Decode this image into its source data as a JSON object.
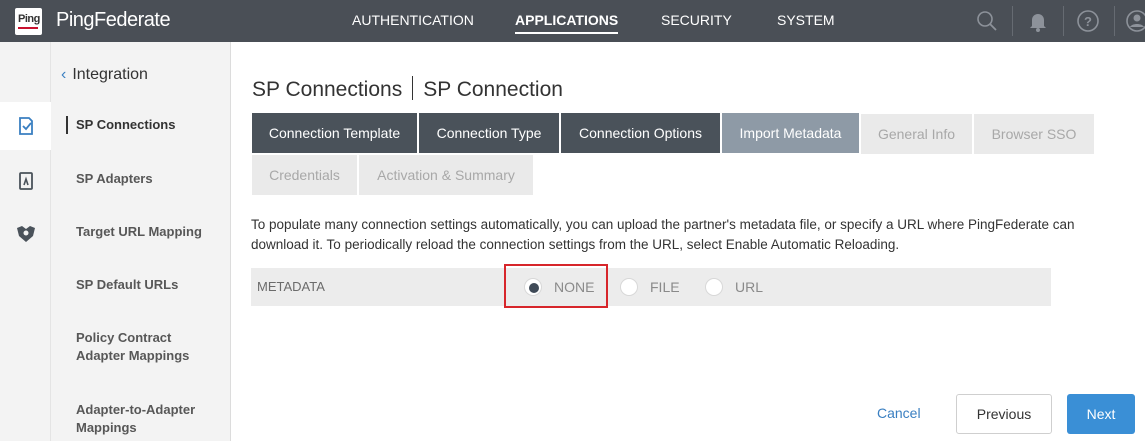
{
  "header": {
    "logo_text": "Ping",
    "brand": "PingFederate",
    "nav": [
      {
        "label": "AUTHENTICATION"
      },
      {
        "label": "APPLICATIONS"
      },
      {
        "label": "SECURITY"
      },
      {
        "label": "SYSTEM"
      }
    ],
    "icons": [
      "search-icon",
      "bell-icon",
      "help-icon",
      "user-icon"
    ]
  },
  "sidebar": {
    "back_label": "Integration",
    "items": [
      {
        "label": "SP Connections"
      },
      {
        "label": "SP Adapters"
      },
      {
        "label": "Target URL Mapping"
      },
      {
        "label": "SP Default URLs"
      },
      {
        "label": "Policy Contract Adapter Mappings"
      },
      {
        "label": "Adapter-to-Adapter Mappings"
      }
    ]
  },
  "page": {
    "breadcrumb_parent": "SP Connections",
    "breadcrumb_current": "SP Connection"
  },
  "tabs": [
    {
      "label": "Connection Template",
      "state": "done"
    },
    {
      "label": "Connection Type",
      "state": "done"
    },
    {
      "label": "Connection Options",
      "state": "done"
    },
    {
      "label": "Import Metadata",
      "state": "current"
    },
    {
      "label": "General Info",
      "state": "future"
    },
    {
      "label": "Browser SSO",
      "state": "future"
    },
    {
      "label": "Credentials",
      "state": "future"
    },
    {
      "label": "Activation & Summary",
      "state": "future"
    }
  ],
  "description": "To populate many connection settings automatically, you can upload the partner's metadata file, or specify a URL where PingFederate can download it. To periodically reload the connection settings from the URL, select Enable Automatic Reloading.",
  "metadata": {
    "label": "METADATA",
    "options": [
      {
        "label": "NONE",
        "checked": true
      },
      {
        "label": "FILE",
        "checked": false
      },
      {
        "label": "URL",
        "checked": false
      }
    ]
  },
  "footer": {
    "cancel_label": "Cancel",
    "previous_label": "Previous",
    "next_label": "Next"
  },
  "colors": {
    "topbar": "#4a4f56",
    "tab_done": "#4a525a",
    "tab_current": "#8e9aa6",
    "accent": "#3a8fd6",
    "highlight": "#d7262b"
  }
}
